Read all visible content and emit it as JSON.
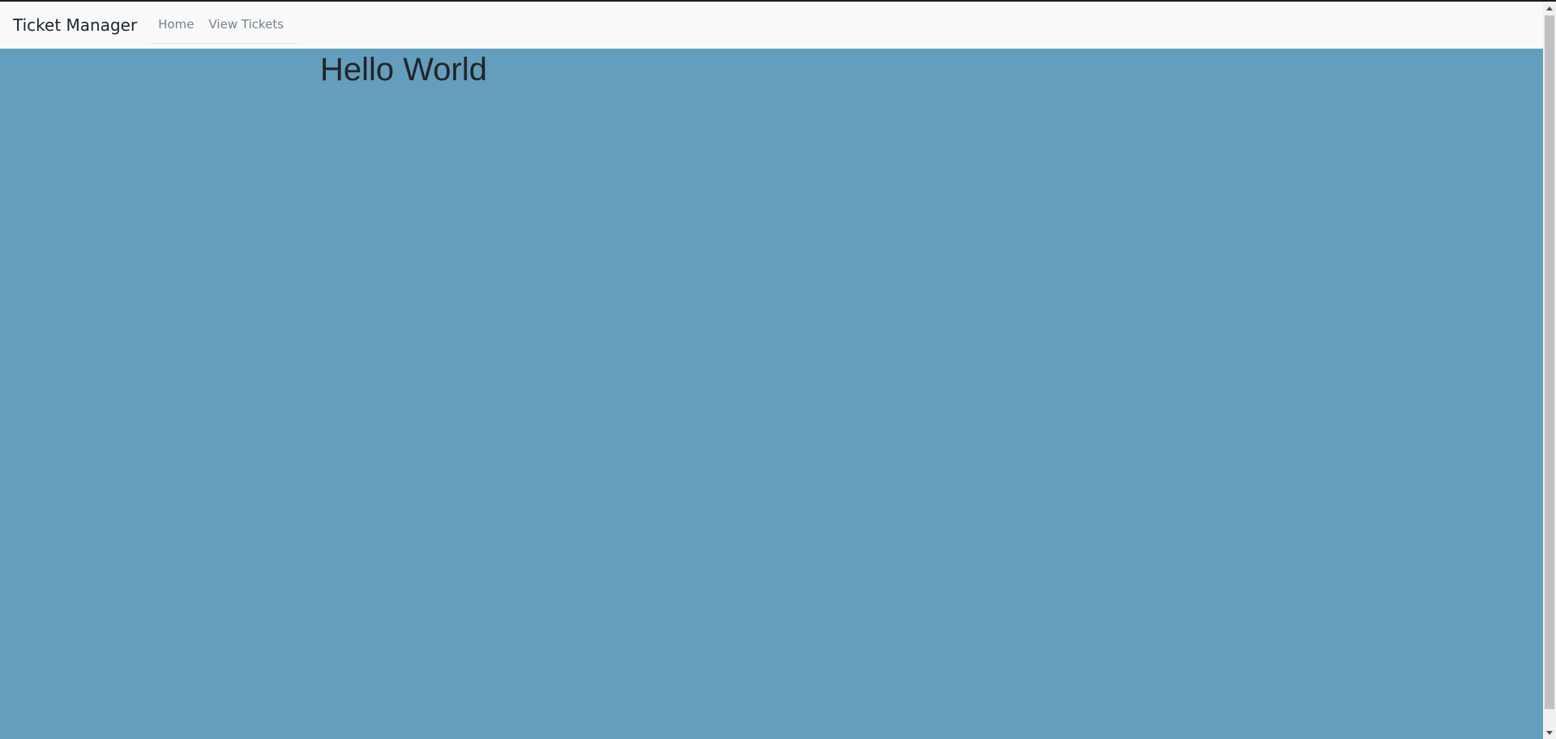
{
  "navbar": {
    "brand": "Ticket Manager",
    "links": [
      {
        "label": "Home"
      },
      {
        "label": "View Tickets"
      }
    ]
  },
  "main": {
    "heading": "Hello World"
  },
  "colors": {
    "page_background": "#649ebd",
    "navbar_background": "#f8f9fa",
    "brand_text": "#212529",
    "nav_link_text": "#7b7f83",
    "heading_text": "#212529"
  },
  "icons": {
    "scroll_up": "chevron-up-icon",
    "scroll_down": "chevron-down-icon"
  }
}
